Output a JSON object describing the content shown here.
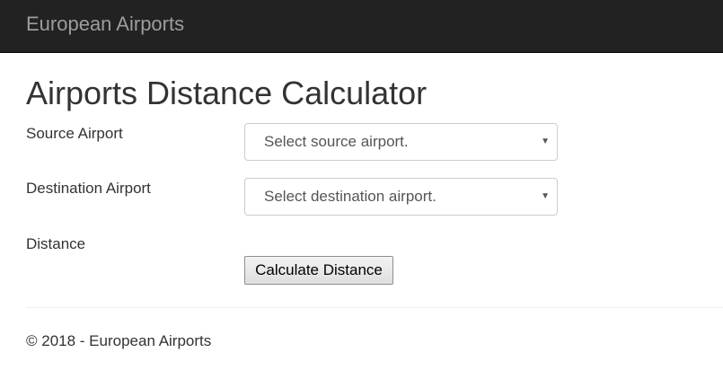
{
  "navbar": {
    "brand": "European Airports"
  },
  "main": {
    "title": "Airports Distance Calculator",
    "source": {
      "label": "Source Airport",
      "selected": "Select source airport."
    },
    "destination": {
      "label": "Destination Airport",
      "selected": "Select destination airport."
    },
    "distance": {
      "label": "Distance"
    },
    "calculate_button": "Calculate Distance"
  },
  "footer": {
    "text": "© 2018 - European Airports"
  },
  "icons": {
    "dropdown": "chevron-down-icon"
  },
  "colors": {
    "navbar_bg": "#222222",
    "brand_text": "#9d9d9d",
    "body_text": "#333333"
  }
}
